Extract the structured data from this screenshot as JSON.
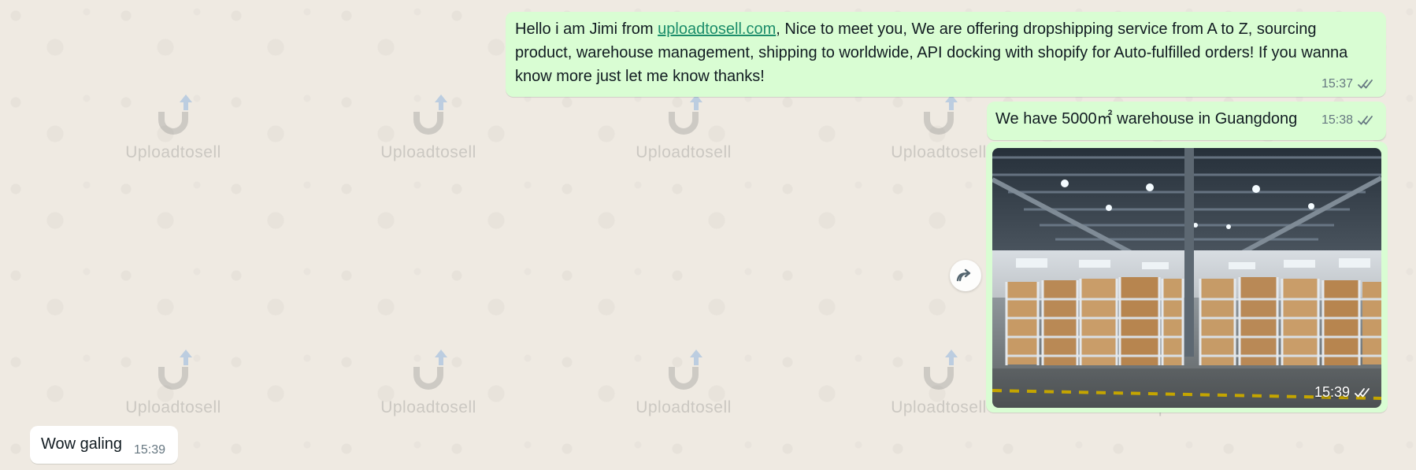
{
  "watermark": {
    "label": "Uploadtosell"
  },
  "messages": {
    "intro": {
      "text_before_link": "Hello i am Jimi from ",
      "link": "uploadtosell.com",
      "text_after_link": ", Nice to meet you, We are offering dropshipping service from A to Z, sourcing product, warehouse management, shipping to worldwide, API docking with shopify for Auto-fulfilled orders! If you wanna know more just let me know thanks!",
      "time": "15:37"
    },
    "warehouse": {
      "text": "We have 5000㎡ warehouse in Guangdong",
      "time": "15:38"
    },
    "photo": {
      "time": "15:39"
    },
    "reply": {
      "text": "Wow galing",
      "time": "15:39"
    }
  },
  "colors": {
    "outgoing_bubble": "#d9fdd3",
    "incoming_bubble": "#ffffff",
    "chat_background": "#efeae2",
    "link": "#1b8d6a",
    "meta_text": "#667781"
  },
  "icons": {
    "forward": "forward-icon",
    "read_receipt": "double-check-icon",
    "watermark_logo": "magnet-upload-logo"
  }
}
